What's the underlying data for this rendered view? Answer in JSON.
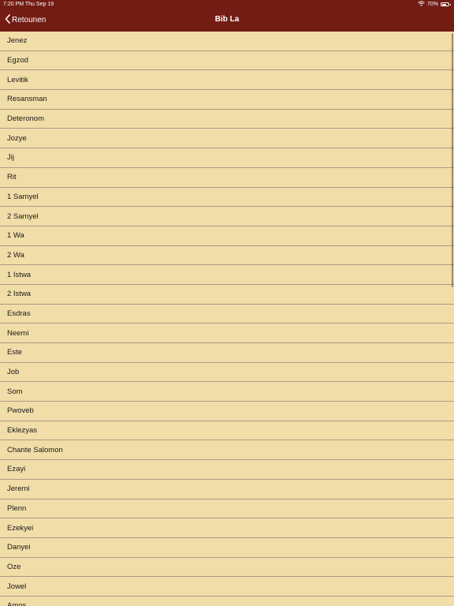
{
  "status_bar": {
    "time_date": "7:20 PM   Thu Sep 19",
    "battery_text": "70%",
    "battery_level": 0.7,
    "icons": [
      "wifi-icon",
      "battery-icon"
    ]
  },
  "nav": {
    "back_label": "Retounen",
    "title": "Bib La",
    "back_icon": "chevron-left-icon"
  },
  "colors": {
    "nav_background": "#731c14",
    "list_background": "#f1dda7",
    "separator": "#a89c84",
    "text": "#1a1a1a"
  },
  "books": [
    "Jenez",
    "Egzod",
    "Levitik",
    "Resansman",
    "Deteronom",
    "Jozye",
    "Jij",
    "Rit",
    "1 Samyel",
    "2 Samyel",
    "1 Wa",
    "2 Wa",
    "1 Istwa",
    "2 Istwa",
    "Esdras",
    "Neemi",
    "Este",
    "Job",
    "Som",
    "Pwoveb",
    "Eklezyas",
    "Chante Salomon",
    "Ezayi",
    "Jeremi",
    "Plenn",
    "Ezekyei",
    "Danyei",
    "Oze",
    "Jowel",
    "Amos"
  ]
}
